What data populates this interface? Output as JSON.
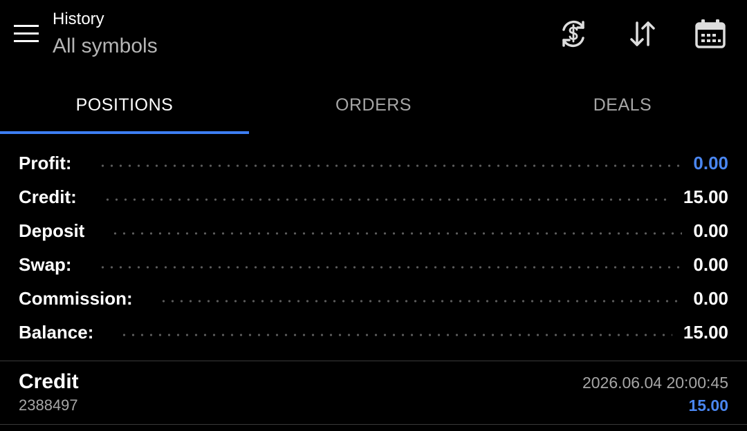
{
  "header": {
    "title": "History",
    "subtitle": "All symbols",
    "icons": [
      "menu-icon",
      "currency-exchange-icon",
      "sort-icon",
      "calendar-icon"
    ]
  },
  "tabs": [
    {
      "label": "POSITIONS",
      "active": true
    },
    {
      "label": "ORDERS",
      "active": false
    },
    {
      "label": "DEALS",
      "active": false
    }
  ],
  "summary": [
    {
      "label": "Profit:",
      "value": "0.00"
    },
    {
      "label": "Credit:",
      "value": "15.00"
    },
    {
      "label": "Deposit",
      "value": "0.00"
    },
    {
      "label": "Swap:",
      "value": "0.00"
    },
    {
      "label": "Commission:",
      "value": "0.00"
    },
    {
      "label": "Balance:",
      "value": "15.00"
    }
  ],
  "deals": [
    {
      "type": "Credit",
      "id": "2388497",
      "time": "2026.06.04 20:00:45",
      "amount": "15.00"
    }
  ],
  "colors": {
    "background": "#000000",
    "accent": "#3d7ef2",
    "positive_value": "#4a86f0",
    "muted_text": "#a6a6a6"
  }
}
